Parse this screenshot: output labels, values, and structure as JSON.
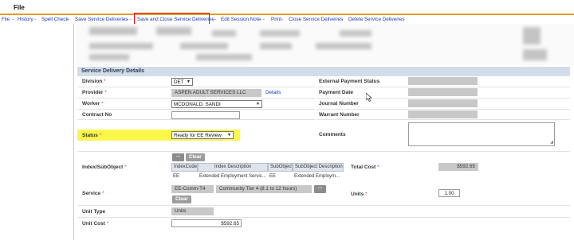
{
  "window": {
    "title": "File"
  },
  "menu": {
    "items": [
      {
        "label": "File",
        "id": "file"
      },
      {
        "label": "History",
        "id": "history"
      },
      {
        "label": "Spell Check",
        "id": "spell-check"
      },
      {
        "label": "Save Service Deliveries",
        "id": "save"
      },
      {
        "label": "Save and Close Service Deliveries",
        "id": "save-close"
      },
      {
        "label": "Edit Session Note",
        "id": "edit-session-note"
      },
      {
        "label": "Print",
        "id": "print"
      },
      {
        "label": "Close Service Deliveries",
        "id": "close"
      },
      {
        "label": "Delete Service Deliveries",
        "id": "delete"
      }
    ],
    "separator": "-",
    "double_separator": "- -"
  },
  "section": {
    "title": "Service Delivery Details"
  },
  "form": {
    "division": {
      "label": "Division",
      "value": "DET"
    },
    "provider": {
      "label": "Provider",
      "value": "ASPEN ADULT SERVICES LLC",
      "link": "Details"
    },
    "worker": {
      "label": "Worker",
      "value": "MCDONALD, SANDI"
    },
    "contract_no": {
      "label": "Contract No",
      "value": ""
    },
    "status": {
      "label": "Status",
      "value": "Ready for EE Review"
    },
    "external_payment_status": {
      "label": "External Payment Status",
      "value": ""
    },
    "payment_date": {
      "label": "Payment Date",
      "value": ""
    },
    "journal_number": {
      "label": "Journal Number",
      "value": ""
    },
    "warrant_number": {
      "label": "Warrant Number",
      "value": ""
    },
    "comments": {
      "label": "Comments",
      "value": ""
    },
    "index_subobject": {
      "label": "Index/SubObject",
      "button_more": "...",
      "button_clear": "Clear",
      "columns": [
        "IndexCode",
        "Index Description",
        "SubObject",
        "SubObject Description"
      ],
      "row": [
        "EE",
        "Extended Employment Servic...",
        "EE",
        "Extended Employm..."
      ]
    },
    "total_cost": {
      "label": "Total Cost",
      "value": "$592.65"
    },
    "service": {
      "label": "Service",
      "code": "EE-Comm-T4",
      "description": "Community Tier 4 (8.1 to 12 hours)",
      "button_more": "...",
      "button_clear": "Clear"
    },
    "units": {
      "label": "Units",
      "value": "1.00"
    },
    "unit_type": {
      "label": "Unit Type",
      "value": "Units"
    },
    "unit_cost": {
      "label": "Unit Cost",
      "value": "$592.65"
    }
  },
  "required_marker": "*",
  "colors": {
    "accent_orange": "#e69a2a",
    "link_blue": "#1a3cb0",
    "highlight_yellow": "#fbf74a",
    "highlight_red": "#dd1111",
    "section_header_bg": "#d3dce9"
  }
}
